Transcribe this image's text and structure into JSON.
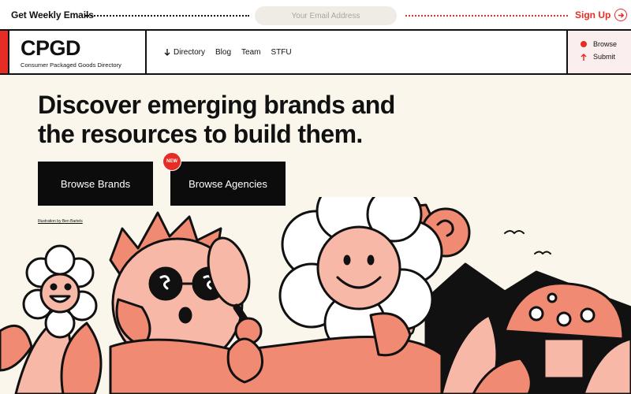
{
  "newsletter": {
    "label": "Get Weekly Emails",
    "email_placeholder": "Your Email Address",
    "signup_label": "Sign Up"
  },
  "header": {
    "logo": "CPGD",
    "tagline": "Consumer Packaged Goods Directory",
    "nav": [
      {
        "label": "Directory",
        "icon": "arrow-down-icon"
      },
      {
        "label": "Blog"
      },
      {
        "label": "Team"
      },
      {
        "label": "STFU"
      }
    ],
    "actions": {
      "browse": "Browse",
      "submit": "Submit"
    }
  },
  "hero": {
    "title_line1": "Discover emerging brands and",
    "title_line2": "the resources to build them.",
    "browse_brands": "Browse Brands",
    "browse_agencies": "Browse Agencies",
    "new_badge": "NEW",
    "credit": "Illustration by Ben Bartels"
  },
  "colors": {
    "accent": "#e62d25",
    "background": "#fbf6ec",
    "dark": "#0c0c0c",
    "salmon": "#f08a72",
    "pink": "#f7b8a8"
  }
}
